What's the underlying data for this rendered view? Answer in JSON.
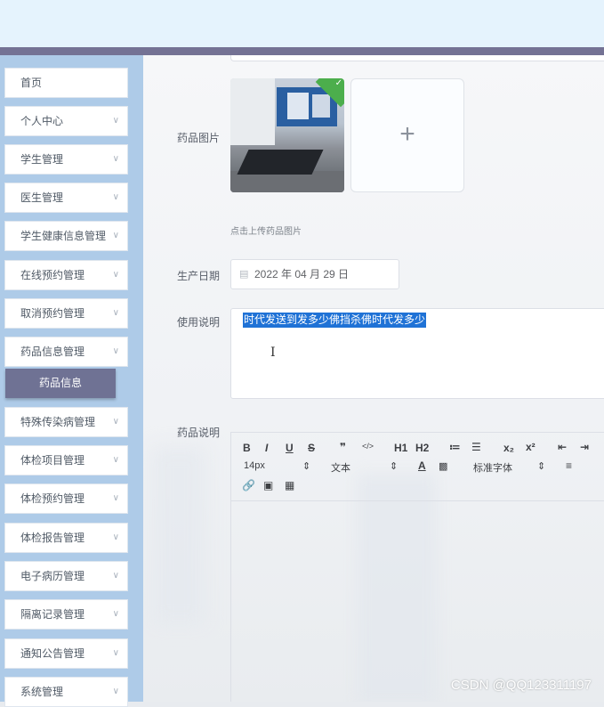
{
  "sidebar": {
    "items": [
      {
        "label": "首页",
        "has_chevron": false
      },
      {
        "label": "个人中心",
        "has_chevron": true
      },
      {
        "label": "学生管理",
        "has_chevron": true
      },
      {
        "label": "医生管理",
        "has_chevron": true
      },
      {
        "label": "学生健康信息管理",
        "has_chevron": true
      },
      {
        "label": "在线预约管理",
        "has_chevron": true
      },
      {
        "label": "取消预约管理",
        "has_chevron": true
      },
      {
        "label": "药品信息管理",
        "has_chevron": true
      },
      {
        "label": "特殊传染病管理",
        "has_chevron": true
      },
      {
        "label": "体检项目管理",
        "has_chevron": true
      },
      {
        "label": "体检预约管理",
        "has_chevron": true
      },
      {
        "label": "体检报告管理",
        "has_chevron": true
      },
      {
        "label": "电子病历管理",
        "has_chevron": true
      },
      {
        "label": "隔离记录管理",
        "has_chevron": true
      },
      {
        "label": "通知公告管理",
        "has_chevron": true
      },
      {
        "label": "系统管理",
        "has_chevron": true
      }
    ],
    "active_sub_item": "药品信息"
  },
  "form": {
    "image_label": "药品图片",
    "upload_hint": "点击上传药品图片",
    "upload_plus": "+",
    "date_label": "生产日期",
    "date_value": "2022 年 04 月 29 日",
    "usage_label": "使用说明",
    "usage_value": "时代发送到发多少佛挡杀佛时代发多少",
    "description_label": "药品说明"
  },
  "editor_toolbar": {
    "bold": "B",
    "italic": "I",
    "underline": "U",
    "strike": "S",
    "quote": "❞",
    "code": "</>",
    "h1": "H1",
    "h2": "H2",
    "ordered_list": "≔",
    "bullet_list": "☰",
    "subscript": "x₂",
    "superscript": "x²",
    "outdent": "⇤",
    "indent": "⇥",
    "font_size": "14px",
    "block_type": "文本",
    "font_family": "标准字体",
    "link_icon": "link-icon",
    "image_icon": "image-icon",
    "video_icon": "video-icon"
  },
  "watermark": "CSDN @QQ123311197",
  "colors": {
    "topbar": "#e5f3fd",
    "accent_bar": "#747294",
    "sidebar_bg": "#aecbe8",
    "active_sub_bg": "#6f7294",
    "selection": "#1f72d6",
    "success_badge": "#4cae4c"
  }
}
